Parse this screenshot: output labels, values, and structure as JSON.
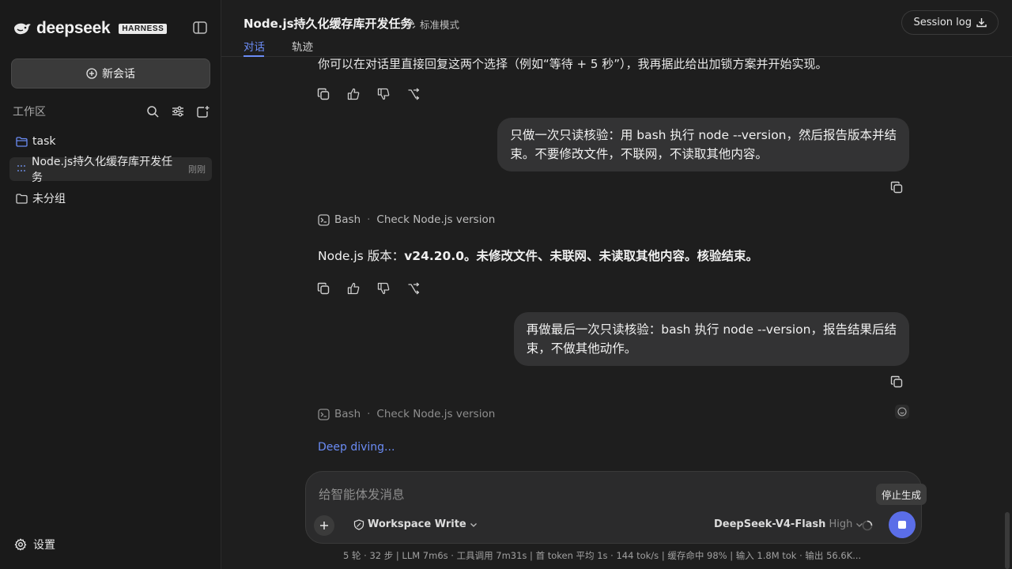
{
  "sidebar": {
    "brand": "deepseek",
    "badge": "HARNESS",
    "new_chat": "新会话",
    "workspace_label": "工作区",
    "items": [
      {
        "label": "task"
      },
      {
        "label": "Node.js持久化缓存库开发任务",
        "meta": "刚刚"
      },
      {
        "label": "未分组"
      }
    ],
    "settings": "设置"
  },
  "header": {
    "title": "Node.js持久化缓存库开发任务",
    "mode": "标准模式",
    "session_log": "Session log",
    "tabs": [
      {
        "label": "对话"
      },
      {
        "label": "轨迹"
      }
    ]
  },
  "conversation": {
    "cut_text": "你可以在对话里直接回复这两个选择（例如“等待 + 5 秒”），我再据此给出加锁方案并开始实现。",
    "user_msg_1": [
      "只做一次只读核验：用 bash 执行 node --version，然后报告版本并结",
      "束。不要修改文件，不联网，不读取其他内容。"
    ],
    "tool_1": {
      "name": "Bash",
      "desc": "Check Node.js version"
    },
    "answer_prefix": "Node.js 版本：",
    "answer_version": "v24.20.0",
    "answer_suffix": "。未修改文件、未联网、未读取其他内容。核验结束。",
    "user_msg_2": [
      "再做最后一次只读核验：bash 执行 node --version，报告结果后结",
      "束，不做其他动作。"
    ],
    "tool_2": {
      "name": "Bash",
      "desc": "Check Node.js version"
    },
    "thinking": "Deep diving..."
  },
  "composer": {
    "placeholder": "给智能体发消息",
    "workspace_mode": "Workspace Write",
    "model": "DeepSeek-V4-Flash",
    "level": "High",
    "stop_tooltip": "停止生成"
  },
  "status_bar": "5 轮 · 32 步   |   LLM 7m6s · 工具调用 7m31s   |   首 token 平均 1s · 144 tok/s   |   缓存命中 98%   |   输入 1.8M tok · 输出 56.6K...",
  "colors": {
    "accent": "#6b8cf5",
    "stop_button": "#5b6ee8",
    "background": "#1e1e1e",
    "sidebar": "#1a1a1a"
  }
}
